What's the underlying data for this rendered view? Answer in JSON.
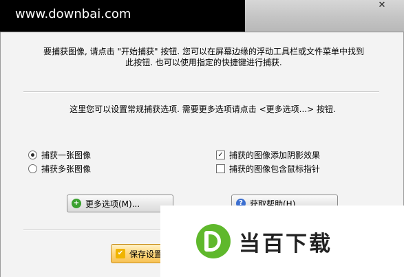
{
  "watermark_top": "www.downbai.com",
  "close_glyph": "✕",
  "intro_line1": "要捕获图像, 请点击 \"开始捕获\" 按钮. 您可以在屏幕边缘的浮动工具栏或文件菜单中找到",
  "intro_line2": "此按钮. 也可以使用指定的快捷键进行捕获.",
  "hint": "这里您可以设置常规捕获选项. 需要更多选项请点击 <更多选项...> 按钮.",
  "capture_mode": {
    "single": {
      "label": "捕获一张图像",
      "checked": true
    },
    "multiple": {
      "label": "捕获多张图像",
      "checked": false
    }
  },
  "options": {
    "shadow": {
      "label": "捕获的图像添加阴影效果",
      "checked": true,
      "mark": "✓"
    },
    "cursor": {
      "label": "捕获的图像包含鼠标指针",
      "checked": false,
      "mark": ""
    }
  },
  "buttons": {
    "more_options": "更多选项(M)...",
    "help": "获取帮助(H)",
    "save": "保存设置"
  },
  "icons": {
    "more_options": "plus-circle-icon",
    "help": "question-icon",
    "save": "check-icon"
  },
  "icon_glyphs": {
    "plus": "+",
    "question": "?",
    "check": "✔"
  },
  "logo_text": "当百下载",
  "colors": {
    "logo_green": "#5fb82c",
    "save_gold": "#f7c255"
  }
}
